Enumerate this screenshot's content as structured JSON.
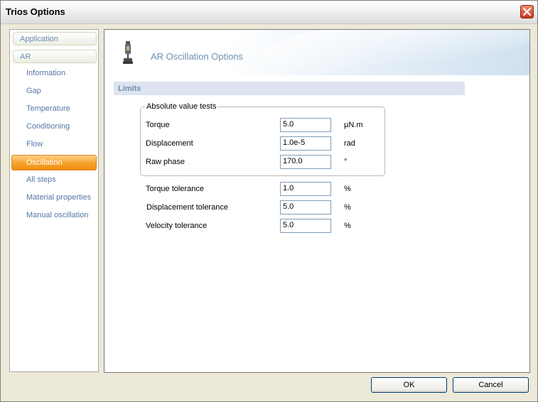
{
  "window": {
    "title": "Trios Options"
  },
  "sidebar": {
    "categories": [
      {
        "label": "Application"
      },
      {
        "label": "AR"
      }
    ],
    "items": [
      {
        "label": "Information"
      },
      {
        "label": "Gap"
      },
      {
        "label": "Temperature"
      },
      {
        "label": "Conditioning"
      },
      {
        "label": "Flow"
      },
      {
        "label": "Oscillation",
        "selected": true
      },
      {
        "label": "All steps"
      },
      {
        "label": "Material properties"
      },
      {
        "label": "Manual oscillation"
      }
    ]
  },
  "content": {
    "title": "AR Oscillation Options",
    "section": "Limits",
    "group_title": "Absolute value tests",
    "absolute_tests": [
      {
        "label": "Torque",
        "value": "5.0",
        "unit": "µN.m"
      },
      {
        "label": "Displacement",
        "value": "1.0e-5",
        "unit": "rad"
      },
      {
        "label": "Raw phase",
        "value": "170.0",
        "unit": "°"
      }
    ],
    "tolerances": [
      {
        "label": "Torque tolerance",
        "value": "1.0",
        "unit": "%"
      },
      {
        "label": "Displacement tolerance",
        "value": "5.0",
        "unit": "%"
      },
      {
        "label": "Velocity tolerance",
        "value": "5.0",
        "unit": "%"
      }
    ]
  },
  "buttons": {
    "ok": "OK",
    "cancel": "Cancel"
  },
  "colors": {
    "selected_item": "#f7a12a",
    "accent_text": "#6f8fb0"
  },
  "icons": {
    "close": "close-icon",
    "header": "rheometer-icon"
  }
}
